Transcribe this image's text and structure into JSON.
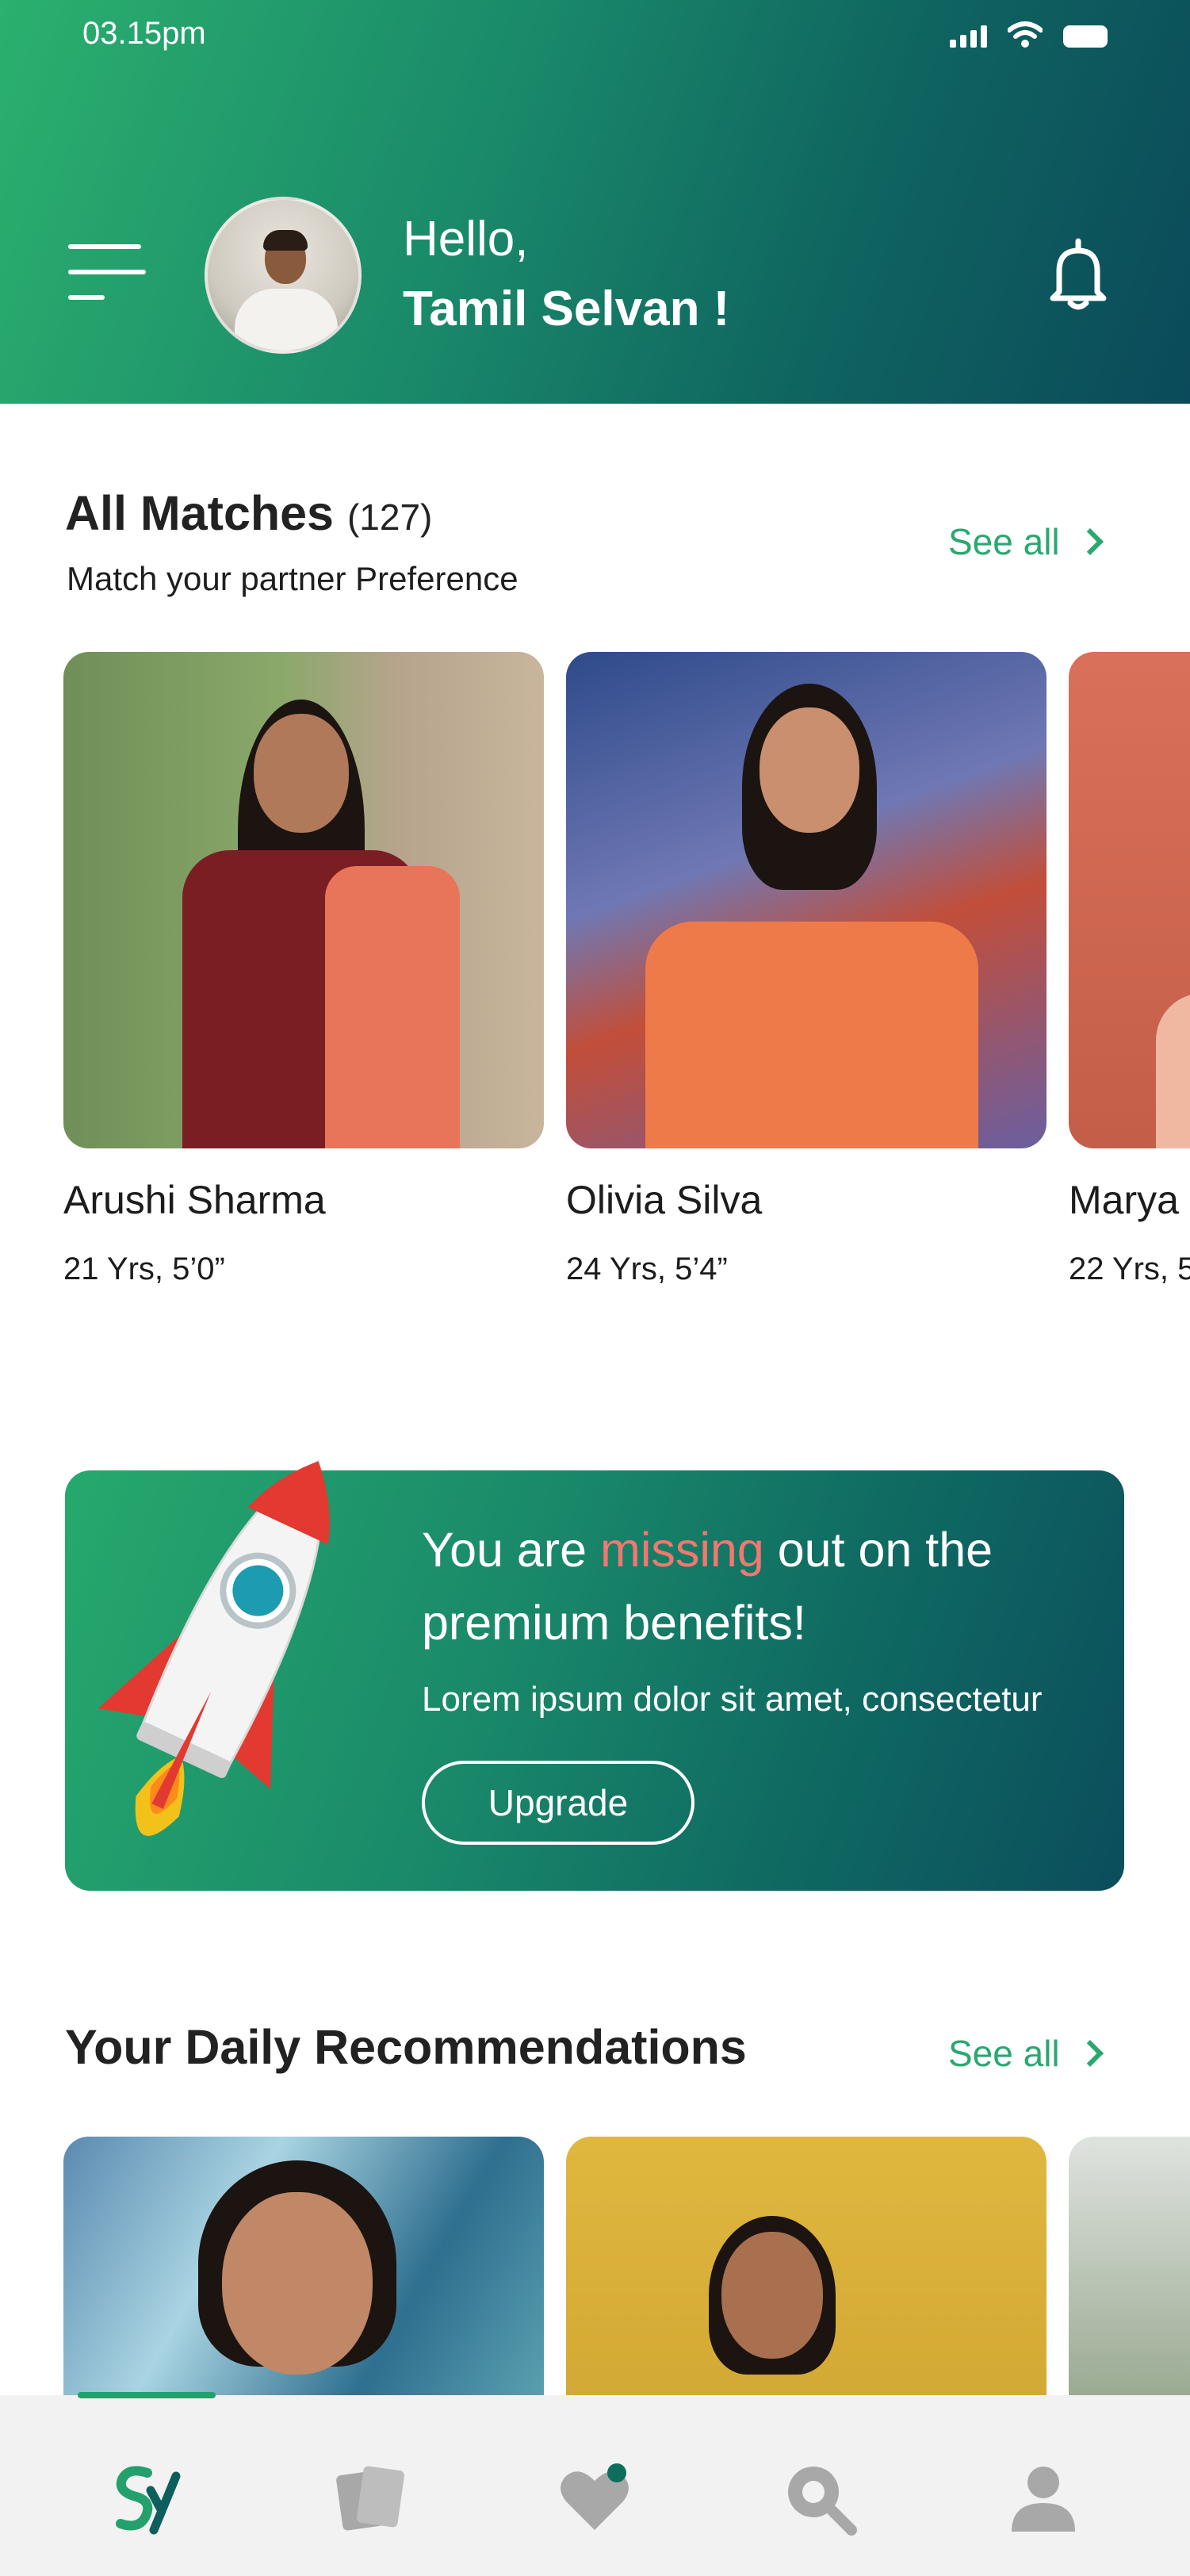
{
  "status_bar": {
    "time": "03.15pm"
  },
  "header": {
    "greeting": "Hello,",
    "user_name": "Tamil Selvan !"
  },
  "all_matches": {
    "title": "All Matches",
    "count": "(127)",
    "subtitle": "Match your partner Preference",
    "see_all": "See all",
    "cards": [
      {
        "name": "Arushi Sharma",
        "meta": "21 Yrs, 5’0”"
      },
      {
        "name": "Olivia Silva",
        "meta": "24 Yrs, 5’4”"
      },
      {
        "name": "Marya",
        "meta": "22 Yrs, 5"
      }
    ]
  },
  "promo": {
    "title_start": "You are ",
    "title_highlight": "missing",
    "title_end": " out on the premium benefits!",
    "description": "Lorem ipsum dolor sit amet, consectetur",
    "button": "Upgrade",
    "highlight_color": "#f07870"
  },
  "daily": {
    "title": "Your Daily Recommendations",
    "see_all": "See all"
  },
  "nav": {
    "items": [
      "home-logo-icon",
      "cards-icon",
      "heart-icon",
      "search-icon",
      "profile-icon"
    ],
    "active_color": "#24a06c",
    "inactive_color": "#a8a8a8"
  },
  "colors": {
    "brand_green": "#2aa870",
    "header_dark": "#0b4a5a"
  }
}
